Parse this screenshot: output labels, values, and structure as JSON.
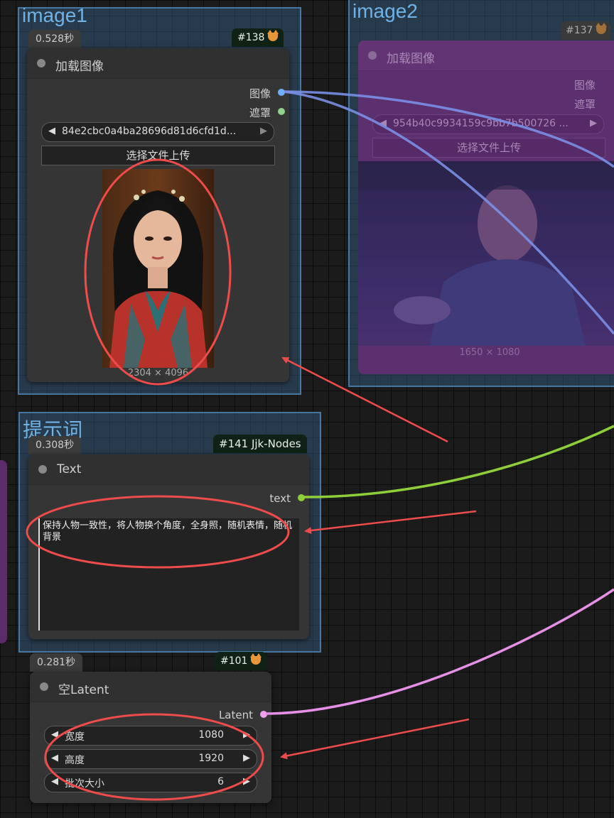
{
  "groups": {
    "image1": "image1",
    "image2": "image2",
    "prompt": "提示词"
  },
  "node_138": {
    "time": "0.528秒",
    "id": "#138",
    "title": "加载图像",
    "out_image": "图像",
    "out_mask": "遮罩",
    "file": "84e2cbc0a4ba28696d81d6cfd1d...",
    "upload": "选择文件上传",
    "dims": "2304 × 4096"
  },
  "node_137": {
    "id": "#137",
    "title": "加载图像",
    "out_image": "图像",
    "out_mask": "遮罩",
    "file": "954b40c9934159c9bb7b500726 ...",
    "upload": "选择文件上传",
    "dims": "1650 × 1080"
  },
  "node_141": {
    "time": "0.308秒",
    "id": "#141 Jjk-Nodes",
    "title": "Text",
    "out_text": "text",
    "text": "保持人物一致性，将人物换个角度，全身照，随机表情，随机背景"
  },
  "node_101": {
    "time": "0.281秒",
    "id": "#101",
    "title": "空Latent",
    "out_latent": "Latent",
    "width_label": "宽度",
    "width_value": "1080",
    "height_label": "高度",
    "height_value": "1920",
    "batch_label": "批次大小",
    "batch_value": "6"
  },
  "colors": {
    "link_image": "#6a8cff",
    "link_text": "#8fce3b",
    "link_latent": "#e58fe6",
    "annotation": "#ee4b4b",
    "group_title": "#6fb3e6"
  }
}
